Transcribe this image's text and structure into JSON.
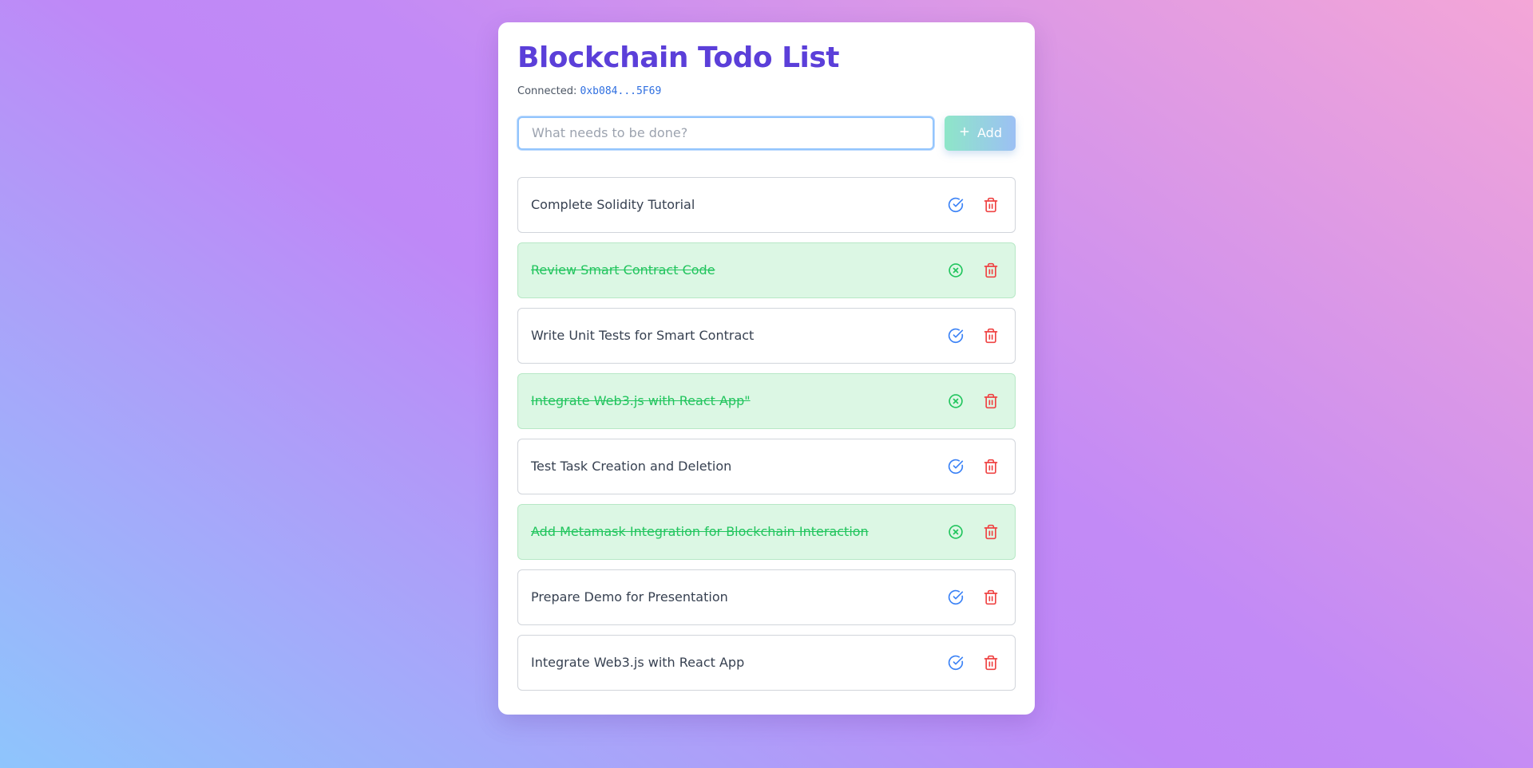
{
  "app": {
    "title": "Blockchain Todo List",
    "connected_label": "Connected:",
    "address": "0xb084...5F69"
  },
  "form": {
    "placeholder": "What needs to be done?",
    "value": "",
    "add_label": "Add"
  },
  "todos": [
    {
      "text": "Complete Solidity Tutorial",
      "completed": false
    },
    {
      "text": "Review Smart Contract Code",
      "completed": true
    },
    {
      "text": "Write Unit Tests for Smart Contract",
      "completed": false
    },
    {
      "text": "Integrate Web3.js with React App\"",
      "completed": true
    },
    {
      "text": "Test Task Creation and Deletion",
      "completed": false
    },
    {
      "text": "Add Metamask Integration for Blockchain Interaction",
      "completed": true
    },
    {
      "text": "Prepare Demo for Presentation",
      "completed": false
    },
    {
      "text": "Integrate Web3.js with React App",
      "completed": false
    }
  ],
  "icons": {
    "add": "plus-icon",
    "complete": "check-circle-icon",
    "undo": "x-circle-icon",
    "delete": "trash-icon"
  },
  "colors": {
    "title": "#5b3fd9",
    "address": "#2f6fe0",
    "complete_icon": "#3b82f6",
    "undo_icon": "#22c55e",
    "delete_icon": "#ef4444",
    "done_background": "#dcf7e4"
  }
}
